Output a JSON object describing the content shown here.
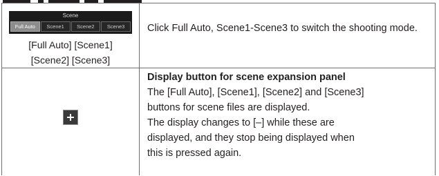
{
  "scene_widget": {
    "title": "Scene",
    "buttons": [
      "Full Auto",
      "Scene1",
      "Scene2",
      "Scene3"
    ],
    "selected": "Full Auto"
  },
  "row1": {
    "caption_line1": "[Full Auto] [Scene1]",
    "caption_line2": "[Scene2] [Scene3]",
    "description": "Click Full Auto, Scene1-Scene3 to switch the shooting mode."
  },
  "row2": {
    "icon": "plus-icon",
    "heading": "Display button for scene expansion panel",
    "line1": "The [Full Auto], [Scene1], [Scene2] and [Scene3]",
    "line2": "buttons for scene files are displayed.",
    "line3": "The display changes to [–] while these are",
    "line4": "displayed, and they stop being displayed when",
    "line5": "this is pressed again."
  }
}
